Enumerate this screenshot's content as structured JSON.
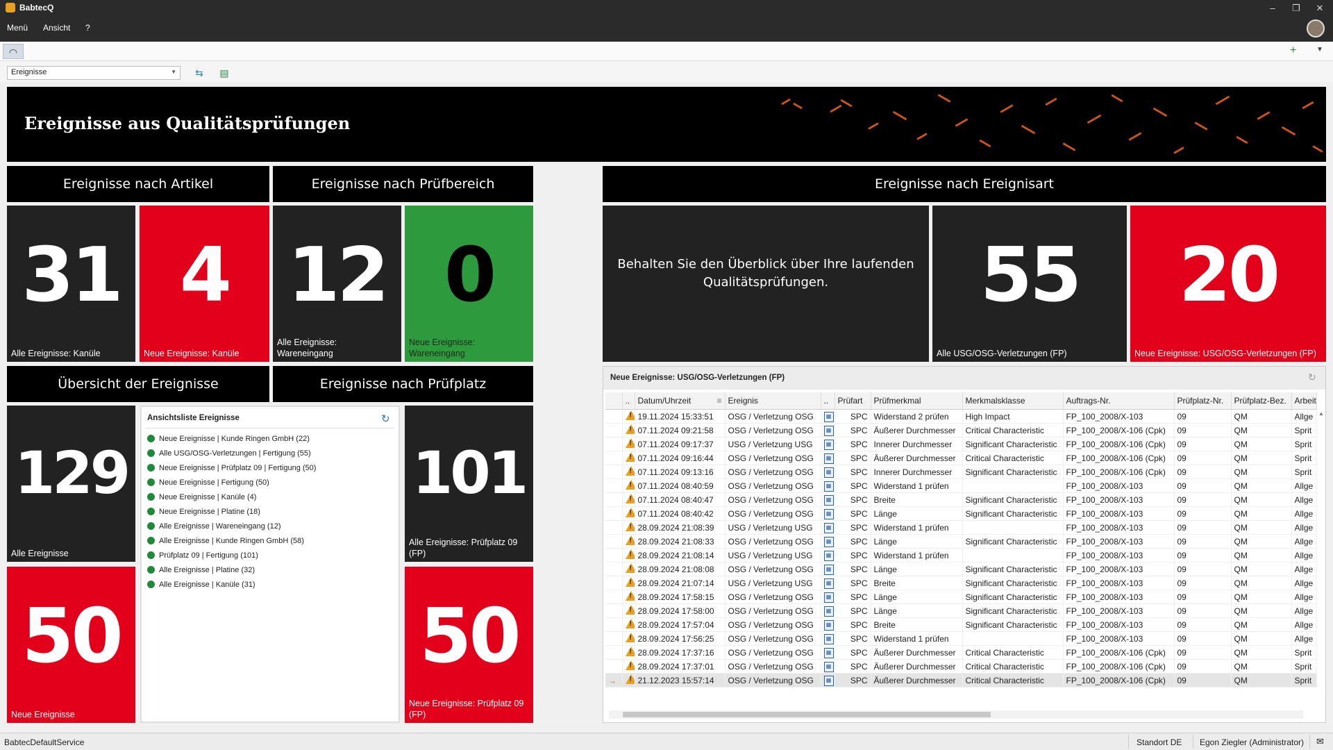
{
  "app": {
    "title": "BabtecQ",
    "menu": [
      "Menü",
      "Ansicht",
      "?"
    ],
    "window_controls": [
      "–",
      "❐",
      "✕"
    ]
  },
  "toolbar": {
    "view_select_value": "Ereignisse"
  },
  "dashboard": {
    "banner_title": "Ereignisse aus Qualitätsprüfungen",
    "headers": {
      "by_article": "Ereignisse nach Artikel",
      "by_area": "Ereignisse nach Prüfbereich",
      "by_type": "Ereignisse nach Ereignisart",
      "overview": "Übersicht der Ereignisse",
      "by_station": "Ereignisse nach Prüfplatz"
    },
    "tiles": {
      "kanule_all": {
        "value": "31",
        "caption": "Alle Ereignisse: Kanüle"
      },
      "kanule_new": {
        "value": "4",
        "caption": "Neue Ereignisse: Kanüle"
      },
      "we_all": {
        "value": "12",
        "caption": "Alle Ereignisse: Wareneingang"
      },
      "we_new": {
        "value": "0",
        "caption": "Neue Ereignisse: Wareneingang"
      },
      "usg_all": {
        "value": "55",
        "caption": "Alle USG/OSG-Verletzungen (FP)"
      },
      "usg_new": {
        "value": "20",
        "caption": "Neue Ereignisse: USG/OSG-Verletzungen (FP)"
      },
      "all_events": {
        "value": "129",
        "caption": "Alle Ereignisse"
      },
      "new_events": {
        "value": "50",
        "caption": "Neue Ereignisse"
      },
      "pp09_all": {
        "value": "101",
        "caption": "Alle Ereignisse: Prüfplatz 09 (FP)"
      },
      "pp09_new": {
        "value": "50",
        "caption": "Neue Ereignisse: Prüfplatz 09 (FP)"
      }
    },
    "intro_text": "Behalten Sie den Überblick über Ihre laufenden Qualitätsprüfungen.",
    "view_list": {
      "title": "Ansichtsliste Ereignisse",
      "items": [
        "Neue Ereignisse | Kunde Ringen GmbH (22)",
        "Alle USG/OSG-Verletzungen | Fertigung (55)",
        "Neue Ereignisse | Prüfplatz 09 | Fertigung (50)",
        "Neue Ereignisse | Fertigung (50)",
        "Neue Ereignisse | Kanüle (4)",
        "Neue Ereignisse | Platine (18)",
        "Alle Ereignisse | Wareneingang (12)",
        "Alle Ereignisse | Kunde Ringen GmbH (58)",
        "Prüfplatz 09 | Fertigung (101)",
        "Alle Ereignisse | Platine (32)",
        "Alle Ereignisse | Kanüle (31)"
      ]
    }
  },
  "grid": {
    "title": "Neue Ereignisse: USG/OSG-Verletzungen (FP)",
    "columns": [
      "..",
      "Datum/Uhrzeit",
      "Ereignis",
      "..",
      "Prüfart",
      "Prüfmerkmal",
      "Merkmalsklasse",
      "Auftrags-Nr.",
      "Prüfplatz-Nr.",
      "Prüfplatz-Bez.",
      "Arbeitsg"
    ],
    "rows": [
      [
        "19.11.2024 15:33:51",
        "OSG / Verletzung OSG",
        "SPC",
        "Widerstand 2 prüfen",
        "High Impact",
        "FP_100_2008/X-103",
        "09",
        "QM",
        "Allge"
      ],
      [
        "07.11.2024 09:21:58",
        "OSG / Verletzung OSG",
        "SPC",
        "Äußerer Durchmesser",
        "Critical Characteristic",
        "FP_100_2008/X-106 (Cpk)",
        "09",
        "QM",
        "Sprit"
      ],
      [
        "07.11.2024 09:17:37",
        "USG / Verletzung USG",
        "SPC",
        "Innerer Durchmesser",
        "Significant Characteristic",
        "FP_100_2008/X-106 (Cpk)",
        "09",
        "QM",
        "Sprit"
      ],
      [
        "07.11.2024 09:16:44",
        "OSG / Verletzung OSG",
        "SPC",
        "Äußerer Durchmesser",
        "Critical Characteristic",
        "FP_100_2008/X-106 (Cpk)",
        "09",
        "QM",
        "Sprit"
      ],
      [
        "07.11.2024 09:13:16",
        "OSG / Verletzung OSG",
        "SPC",
        "Innerer Durchmesser",
        "Significant Characteristic",
        "FP_100_2008/X-106 (Cpk)",
        "09",
        "QM",
        "Sprit"
      ],
      [
        "07.11.2024 08:40:59",
        "OSG / Verletzung OSG",
        "SPC",
        "Widerstand 1 prüfen",
        "",
        "FP_100_2008/X-103",
        "09",
        "QM",
        "Allge"
      ],
      [
        "07.11.2024 08:40:47",
        "OSG / Verletzung OSG",
        "SPC",
        "Breite",
        "Significant Characteristic",
        "FP_100_2008/X-103",
        "09",
        "QM",
        "Allge"
      ],
      [
        "07.11.2024 08:40:42",
        "OSG / Verletzung OSG",
        "SPC",
        "Länge",
        "Significant Characteristic",
        "FP_100_2008/X-103",
        "09",
        "QM",
        "Allge"
      ],
      [
        "28.09.2024 21:08:39",
        "USG / Verletzung USG",
        "SPC",
        "Widerstand 1 prüfen",
        "",
        "FP_100_2008/X-103",
        "09",
        "QM",
        "Allge"
      ],
      [
        "28.09.2024 21:08:33",
        "OSG / Verletzung OSG",
        "SPC",
        "Länge",
        "Significant Characteristic",
        "FP_100_2008/X-103",
        "09",
        "QM",
        "Allge"
      ],
      [
        "28.09.2024 21:08:14",
        "USG / Verletzung USG",
        "SPC",
        "Widerstand 1 prüfen",
        "",
        "FP_100_2008/X-103",
        "09",
        "QM",
        "Allge"
      ],
      [
        "28.09.2024 21:08:08",
        "OSG / Verletzung OSG",
        "SPC",
        "Länge",
        "Significant Characteristic",
        "FP_100_2008/X-103",
        "09",
        "QM",
        "Allge"
      ],
      [
        "28.09.2024 21:07:14",
        "USG / Verletzung USG",
        "SPC",
        "Breite",
        "Significant Characteristic",
        "FP_100_2008/X-103",
        "09",
        "QM",
        "Allge"
      ],
      [
        "28.09.2024 17:58:15",
        "OSG / Verletzung OSG",
        "SPC",
        "Länge",
        "Significant Characteristic",
        "FP_100_2008/X-103",
        "09",
        "QM",
        "Allge"
      ],
      [
        "28.09.2024 17:58:00",
        "OSG / Verletzung OSG",
        "SPC",
        "Länge",
        "Significant Characteristic",
        "FP_100_2008/X-103",
        "09",
        "QM",
        "Allge"
      ],
      [
        "28.09.2024 17:57:04",
        "OSG / Verletzung OSG",
        "SPC",
        "Breite",
        "Significant Characteristic",
        "FP_100_2008/X-103",
        "09",
        "QM",
        "Allge"
      ],
      [
        "28.09.2024 17:56:25",
        "OSG / Verletzung OSG",
        "SPC",
        "Widerstand 1 prüfen",
        "",
        "FP_100_2008/X-103",
        "09",
        "QM",
        "Allge"
      ],
      [
        "28.09.2024 17:37:16",
        "OSG / Verletzung OSG",
        "SPC",
        "Äußerer Durchmesser",
        "Critical Characteristic",
        "FP_100_2008/X-106 (Cpk)",
        "09",
        "QM",
        "Sprit"
      ],
      [
        "28.09.2024 17:37:01",
        "OSG / Verletzung OSG",
        "SPC",
        "Äußerer Durchmesser",
        "Critical Characteristic",
        "FP_100_2008/X-106 (Cpk)",
        "09",
        "QM",
        "Sprit"
      ],
      [
        "21.12.2023 15:57:14",
        "OSG / Verletzung OSG",
        "SPC",
        "Äußerer Durchmesser",
        "Critical Characteristic",
        "FP_100_2008/X-106 (Cpk)",
        "09",
        "QM",
        "Sprit"
      ]
    ],
    "selected_row": 19
  },
  "status": {
    "service": "BabtecDefaultService",
    "location": "Standort DE",
    "user": "Egon Ziegler (Administrator)"
  },
  "colors": {
    "red": "#e2001a",
    "green": "#2e9a3e",
    "dark": "#222222",
    "accent_orange": "#c8541e"
  }
}
